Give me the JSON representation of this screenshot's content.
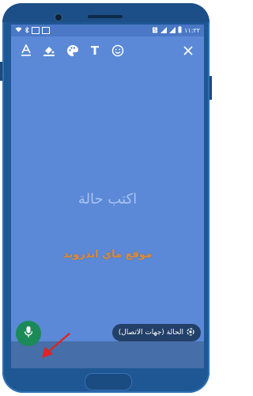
{
  "statusbar": {
    "time": "١١:٢٢",
    "left_icons": [
      "wifi-icon",
      "bluetooth-icon",
      "image-icon",
      "image-icon"
    ],
    "right_icons": [
      "battery-icon",
      "signal-icon",
      "signal-icon",
      "sim-icon"
    ]
  },
  "toolbar": {
    "items": [
      "text-font-icon",
      "fill-color-icon",
      "palette-icon",
      "text-icon",
      "emoji-icon"
    ],
    "close": "close-icon",
    "text_glyph": "T"
  },
  "composer": {
    "placeholder": "اكتب حالة"
  },
  "watermark": {
    "text": "موقع ماي اندرويد"
  },
  "bottom": {
    "status_label": "الحالة (جهات الاتصال)",
    "mic_icon": "mic-icon"
  },
  "colors": {
    "screen_bg": "#5b89d7",
    "mic_bg": "#1b8a58",
    "watermark": "#e08a2f",
    "arrow": "#e02323"
  }
}
